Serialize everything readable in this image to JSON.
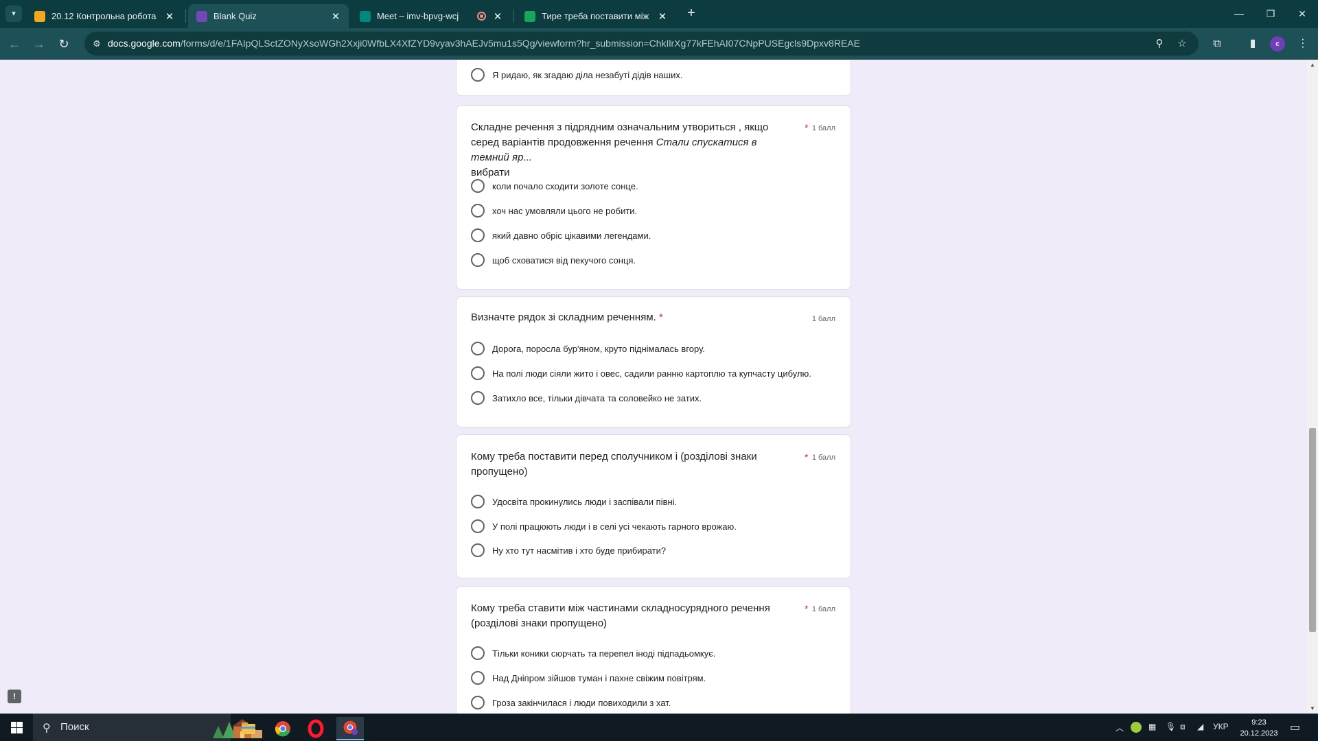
{
  "browser": {
    "tabs": [
      {
        "title": "20.12 Контрольна робота",
        "favicon_color": "#f4a81d",
        "active": false
      },
      {
        "title": "Blank Quiz",
        "favicon_color": "#7248b9",
        "active": true
      },
      {
        "title": "Meet – imv-bpvg-wcj",
        "favicon_color": "#00897b",
        "active": false
      },
      {
        "title": "Тире треба поставити між час",
        "favicon_color": "#17a65a",
        "active": false
      }
    ],
    "close_glyph": "✕",
    "new_tab_glyph": "+",
    "url": {
      "domain": "docs.google.com",
      "path": "/forms/d/e/1FAIpQLSctZONyXsoWGh2Xxji0WfbLX4XfZYD9vyav3hAEJv5mu1s5Qg/viewform?hr_submission=ChkIlrXg77kFEhAI07CNpPUSEgcls9Dpxv8REAE"
    },
    "profile_initial": "є"
  },
  "form": {
    "prev_card": {
      "last_option": "Я ридаю, як згадаю діла незабуті дідів наших."
    },
    "questions": [
      {
        "title_plain": "Складне речення з підрядним означальним утвориться , якщо серед варіантів продовження речення ",
        "title_italic": "Стали спускатися в темний яр...",
        "title_tail": "вибрати",
        "required": "*",
        "points": "1 балл",
        "options": [
          "коли почало сходити золоте сонце.",
          "хоч нас умовляли цього не робити.",
          "який давно обріс цікавими легендами.",
          "щоб сховатися від пекучого сонця."
        ]
      },
      {
        "title": "Визначте рядок зі складним реченням.",
        "required": "*",
        "points": "1 балл",
        "options": [
          "Дорога, поросла бур'яном, круто піднімалась вгору.",
          "На полі люди сіяли жито і овес, садили ранню картоплю та купчасту цибулю.",
          "Затихло все, тільки дівчата та соловейко не затих."
        ]
      },
      {
        "title": "Кому треба поставити перед сполучником і (розділові знаки пропущено)",
        "required": "*",
        "points": "1 балл",
        "options": [
          "Удосвіта прокинулись люди і заспівали півні.",
          "У полі працюють люди і в селі усі чекають гарного врожаю.",
          "Ну хто тут насмітив і хто буде прибирати?"
        ]
      },
      {
        "title": "Кому  треба ставити між частинами складносурядного речення (розділові знаки пропущено)",
        "required": "*",
        "points": "1 балл",
        "options": [
          "Тільки коники сюрчать та перепел іноді підпадьомкує.",
          "Над Дніпром зійшов туман і пахне свіжим повітрям.",
          "Гроза закінчилася і люди повиходили з хат."
        ]
      }
    ],
    "feedback_glyph": "!"
  },
  "taskbar": {
    "search_placeholder": "Поиск",
    "language": "УКР",
    "time": "9:23",
    "date": "20.12.2023"
  }
}
